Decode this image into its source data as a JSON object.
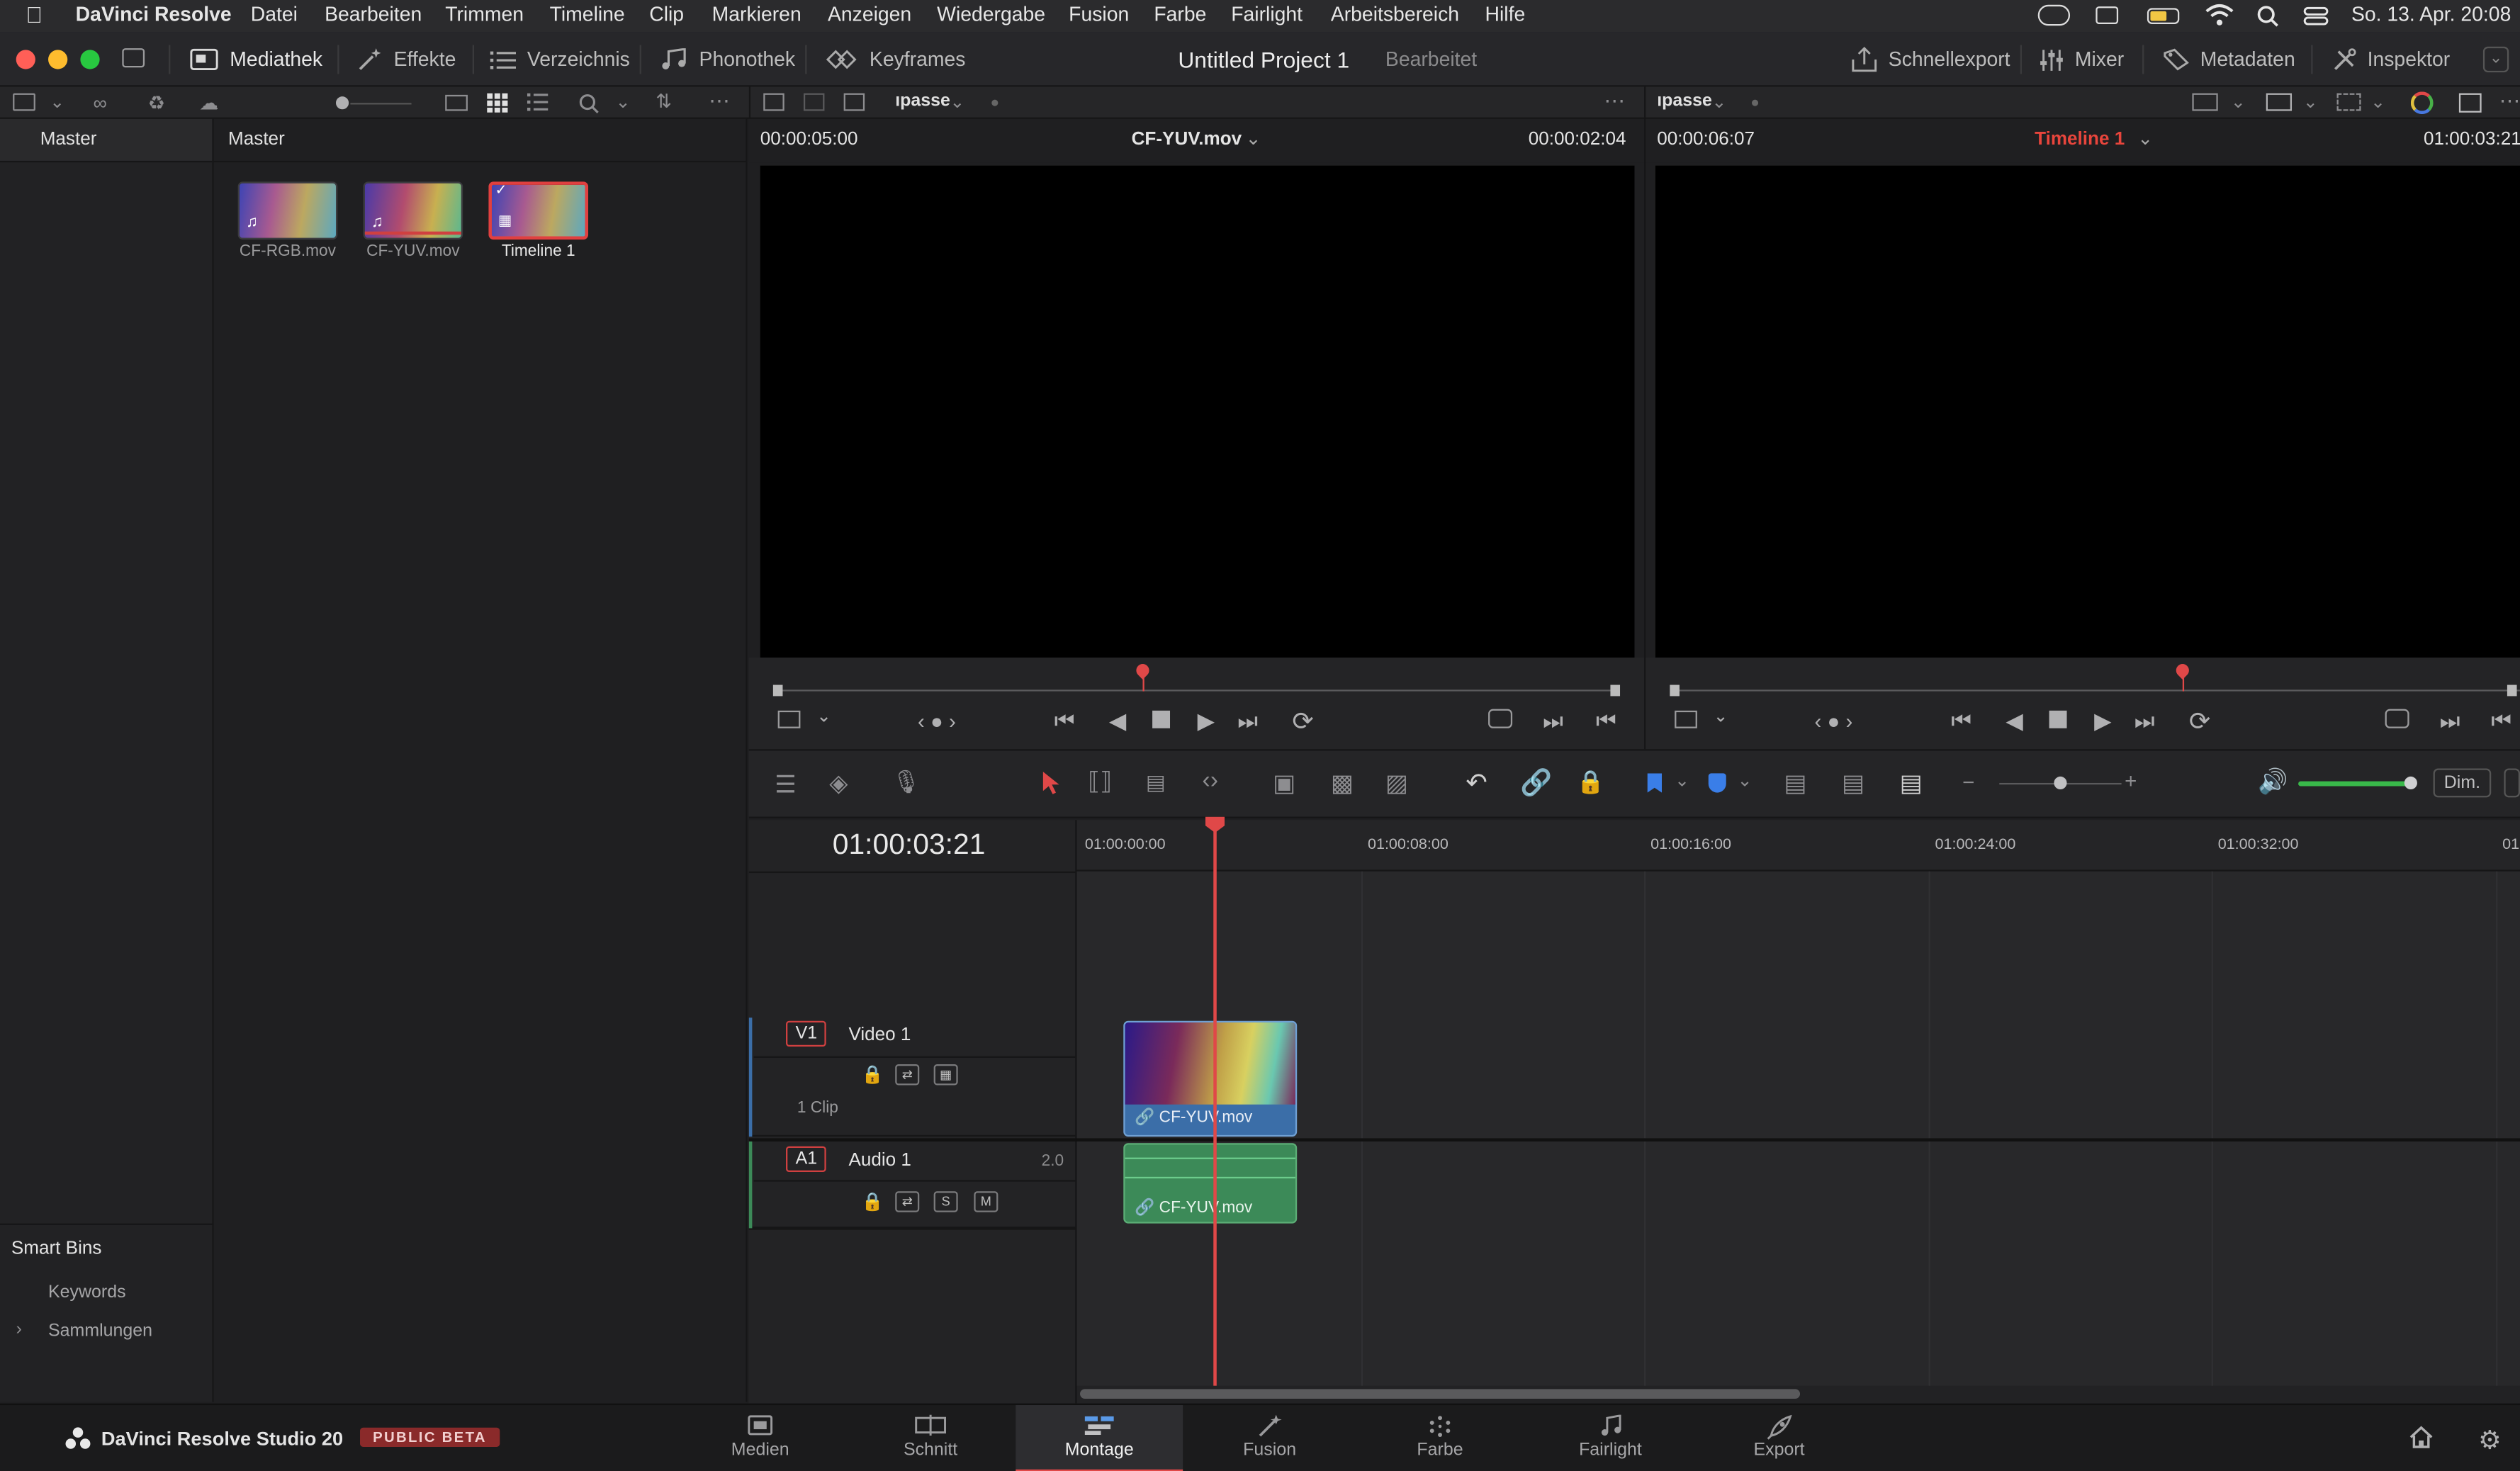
{
  "menubar": {
    "app": "DaVinci Resolve",
    "items": [
      "Datei",
      "Bearbeiten",
      "Trimmen",
      "Timeline",
      "Clip",
      "Markieren",
      "Anzeigen",
      "Wiedergabe",
      "Fusion",
      "Farbe",
      "Fairlight",
      "Arbeitsbereich",
      "Hilfe"
    ],
    "datetime": "So. 13. Apr.  20:08"
  },
  "toolbar": {
    "media_pool": "Mediathek",
    "effects": "Effekte",
    "index": "Verzeichnis",
    "sound_library": "Phonothek",
    "keyframes": "Keyframes",
    "project_title": "Untitled Project 1",
    "project_status": "Bearbeitet",
    "quick_export": "Schnellexport",
    "mixer": "Mixer",
    "metadata": "Metadaten",
    "inspector": "Inspektor"
  },
  "subbar": {
    "source_zoom": "ıpasse",
    "timeline_zoom": "ıpasse"
  },
  "left_panel": {
    "header": "Master",
    "smart_bins": "Smart Bins",
    "keywords": "Keywords",
    "collections": "Sammlungen"
  },
  "bin": {
    "header": "Master",
    "clips": [
      {
        "name": "CF-RGB.mov"
      },
      {
        "name": "CF-YUV.mov"
      },
      {
        "name": "Timeline 1"
      }
    ]
  },
  "source_viewer": {
    "duration": "00:00:05:00",
    "clip_name": "CF-YUV.mov",
    "timecode": "00:00:02:04",
    "playhead_fraction": 0.435
  },
  "timeline_viewer": {
    "duration": "00:00:06:07",
    "timeline_name": "Timeline 1",
    "timecode": "01:00:03:21",
    "playhead_fraction": 0.6
  },
  "timeline": {
    "current_timecode": "01:00:03:21",
    "ruler_ticks": [
      "01:00:00:00",
      "01:00:08:00",
      "01:00:16:00",
      "01:00:24:00",
      "01:00:32:00",
      "01"
    ],
    "tracks": [
      {
        "id": "V1",
        "name": "Video 1",
        "info": "1 Clip"
      },
      {
        "id": "A1",
        "name": "Audio 1",
        "channels": "2.0",
        "solo": "S",
        "mute": "M"
      }
    ],
    "video_clip": "CF-YUV.mov",
    "audio_clip": "CF-YUV.mov",
    "dim_label": "Dim."
  },
  "bottom": {
    "product": "DaVinci Resolve Studio 20",
    "badge": "PUBLIC BETA",
    "pages": [
      "Medien",
      "Schnitt",
      "Montage",
      "Fusion",
      "Farbe",
      "Fairlight",
      "Export"
    ],
    "active_page": "Montage"
  },
  "colors": {
    "accent_red": "#e04848",
    "video_clip": "#3b6ea8",
    "audio_clip": "#3c8a58",
    "timeline_name": "#e8453c"
  }
}
